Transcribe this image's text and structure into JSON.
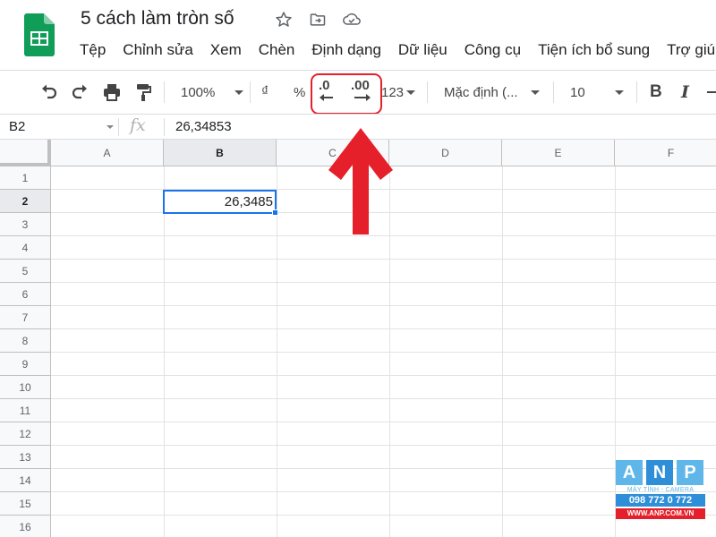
{
  "title_bar": {
    "doc_title": "5 cách làm tròn số",
    "icons": [
      "star-icon",
      "move-folder-icon",
      "cloud-status-icon"
    ]
  },
  "menu": [
    "Tệp",
    "Chỉnh sửa",
    "Xem",
    "Chèn",
    "Định dạng",
    "Dữ liệu",
    "Công cụ",
    "Tiện ích bổ sung",
    "Trợ giúp"
  ],
  "toolbar": {
    "zoom": "100%",
    "currency": "₫",
    "percent": "%",
    "decrease_decimal": ".0",
    "increase_decimal": ".00",
    "more_formats": "123",
    "font": "Mặc định (...",
    "font_size": "10",
    "bold": "B",
    "italic": "I"
  },
  "formula_bar": {
    "name_box": "B2",
    "fx": "fx",
    "value": "26,34853"
  },
  "sheet": {
    "columns": [
      "A",
      "B",
      "C",
      "D",
      "E",
      "F"
    ],
    "rows": [
      "1",
      "2",
      "3",
      "4",
      "5",
      "6",
      "7",
      "8",
      "9",
      "10",
      "11",
      "12",
      "13",
      "14",
      "15",
      "16"
    ],
    "b2_display": "26,3485",
    "active_cell": "B2"
  },
  "watermark": {
    "letter_a": "A",
    "letter_n": "N",
    "letter_p": "P",
    "tagline": "MÁY TÍNH - CAMERA",
    "phone": "098 772 0 772",
    "site": "WWW.ANP.COM.VN"
  },
  "colors": {
    "accent": "#1a73e8",
    "highlight": "#e5202a",
    "sheets_green": "#0f9d58"
  }
}
